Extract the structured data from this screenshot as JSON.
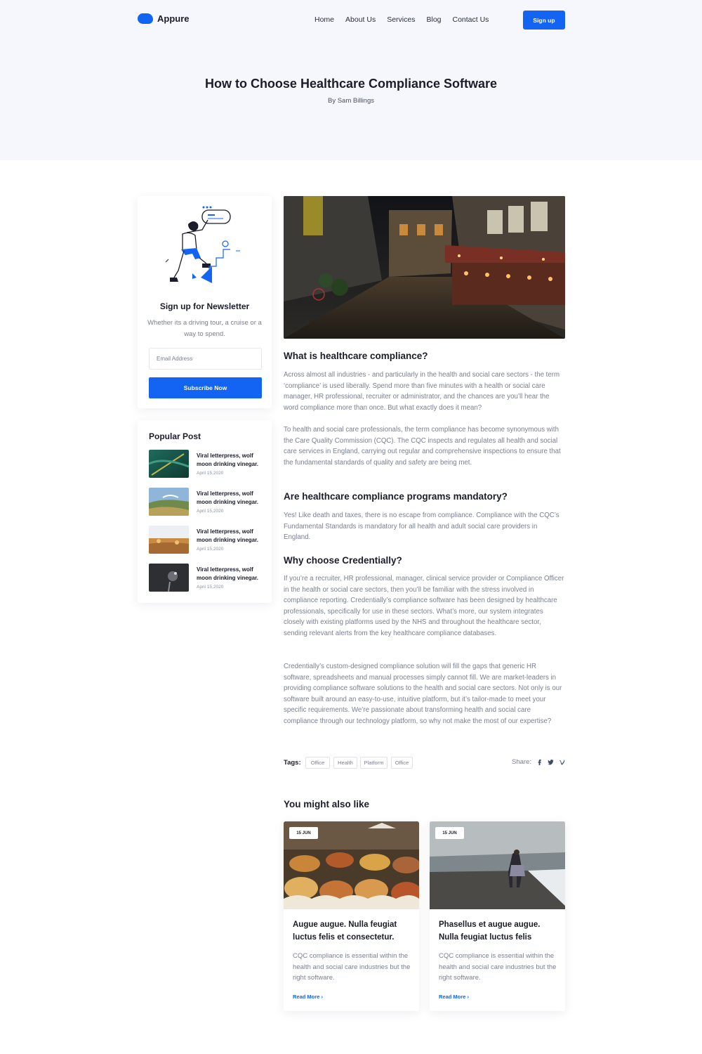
{
  "brand": {
    "name": "Appure",
    "accent": "#1464f4"
  },
  "nav": {
    "items": [
      "Home",
      "About Us",
      "Services",
      "Blog",
      "Contact Us"
    ],
    "signup_label": "Sign up"
  },
  "hero": {
    "title": "How to Choose Healthcare Compliance Software",
    "byline": "By Sam Billings"
  },
  "newsletter": {
    "title": "Sign up for Newsletter",
    "description": "Whether its a driving tour, a cruise or a way to spend.",
    "email_placeholder": "Email Address",
    "button_label": "Subscribe Now"
  },
  "popular": {
    "title": "Popular Post",
    "items": [
      {
        "title": "Viral letterpress, wolf moon drinking vinegar.",
        "date": "April 15,2020"
      },
      {
        "title": "Viral letterpress, wolf moon drinking vinegar.",
        "date": "April 15,2020"
      },
      {
        "title": "Viral letterpress, wolf moon drinking vinegar.",
        "date": "April 15,2020"
      },
      {
        "title": "Viral letterpress, wolf moon drinking vinegar.",
        "date": "April 15,2020"
      }
    ]
  },
  "article": {
    "sections": [
      {
        "heading": "What is healthcare compliance?",
        "paragraphs": [
          "Across almost all industries - and particularly in the health and social care sectors - the term ‘compliance’ is used liberally. Spend more than five minutes with a health or social care manager, HR professional, recruiter or administrator, and the chances are you’ll hear the word compliance more than once. But what exactly does it mean?",
          "To health and social care professionals, the term compliance has become synonymous with the Care Quality Commission (CQC). The CQC inspects and regulates all health and social care services in England, carrying out regular and comprehensive inspections to ensure that the fundamental standards of quality and safety are being met."
        ]
      },
      {
        "heading": "Are healthcare compliance programs mandatory?",
        "paragraphs": [
          "Yes! Like death and taxes, there is no escape from compliance. Compliance with the CQC’s Fundamental Standards is mandatory for all health and adult social care providers in England."
        ]
      },
      {
        "heading": "Why choose Credentially?",
        "paragraphs": [
          "If you’re a recruiter, HR professional, manager, clinical service provider or Compliance Officer in the health or social care sectors, then you’ll be familiar with the stress involved in compliance reporting. Credentially’s compliance software has been designed by healthcare professionals, specifically for use in these sectors. What’s more, our system integrates closely with existing platforms used by the NHS and throughout the healthcare sector, sending relevant alerts from the key healthcare compliance databases.",
          "Credentially’s custom-designed compliance solution will fill the gaps that generic HR software, spreadsheets and manual processes simply cannot fill. We are market-leaders in providing compliance software solutions to the health and social care sectors. Not only is our software built around an easy-to-use, intuitive platform, but it’s tailor-made to meet your specific requirements. We’re passionate about transforming health and social care compliance through our technology platform, so why not make the most of our expertise?"
        ]
      }
    ],
    "tags_label": "Tags:",
    "tags": [
      "Office",
      "Health",
      "Platform",
      "Office"
    ],
    "share_label": "Share:",
    "share_icons": [
      "facebook-icon",
      "twitter-icon",
      "vimeo-icon"
    ]
  },
  "related": {
    "title": "You might also like",
    "cards": [
      {
        "date": "15 JUN",
        "title": "Augue augue. Nulla feugiat luctus felis et consectetur.",
        "description": "CQC compliance is essential within the health and social care industries but the right software.",
        "link": "Read More"
      },
      {
        "date": "15 JUN",
        "title": "Phasellus et augue augue. Nulla feugiat luctus felis",
        "description": "CQC compliance is essential within the health and social care industries but the right software.",
        "link": "Read More"
      }
    ]
  }
}
